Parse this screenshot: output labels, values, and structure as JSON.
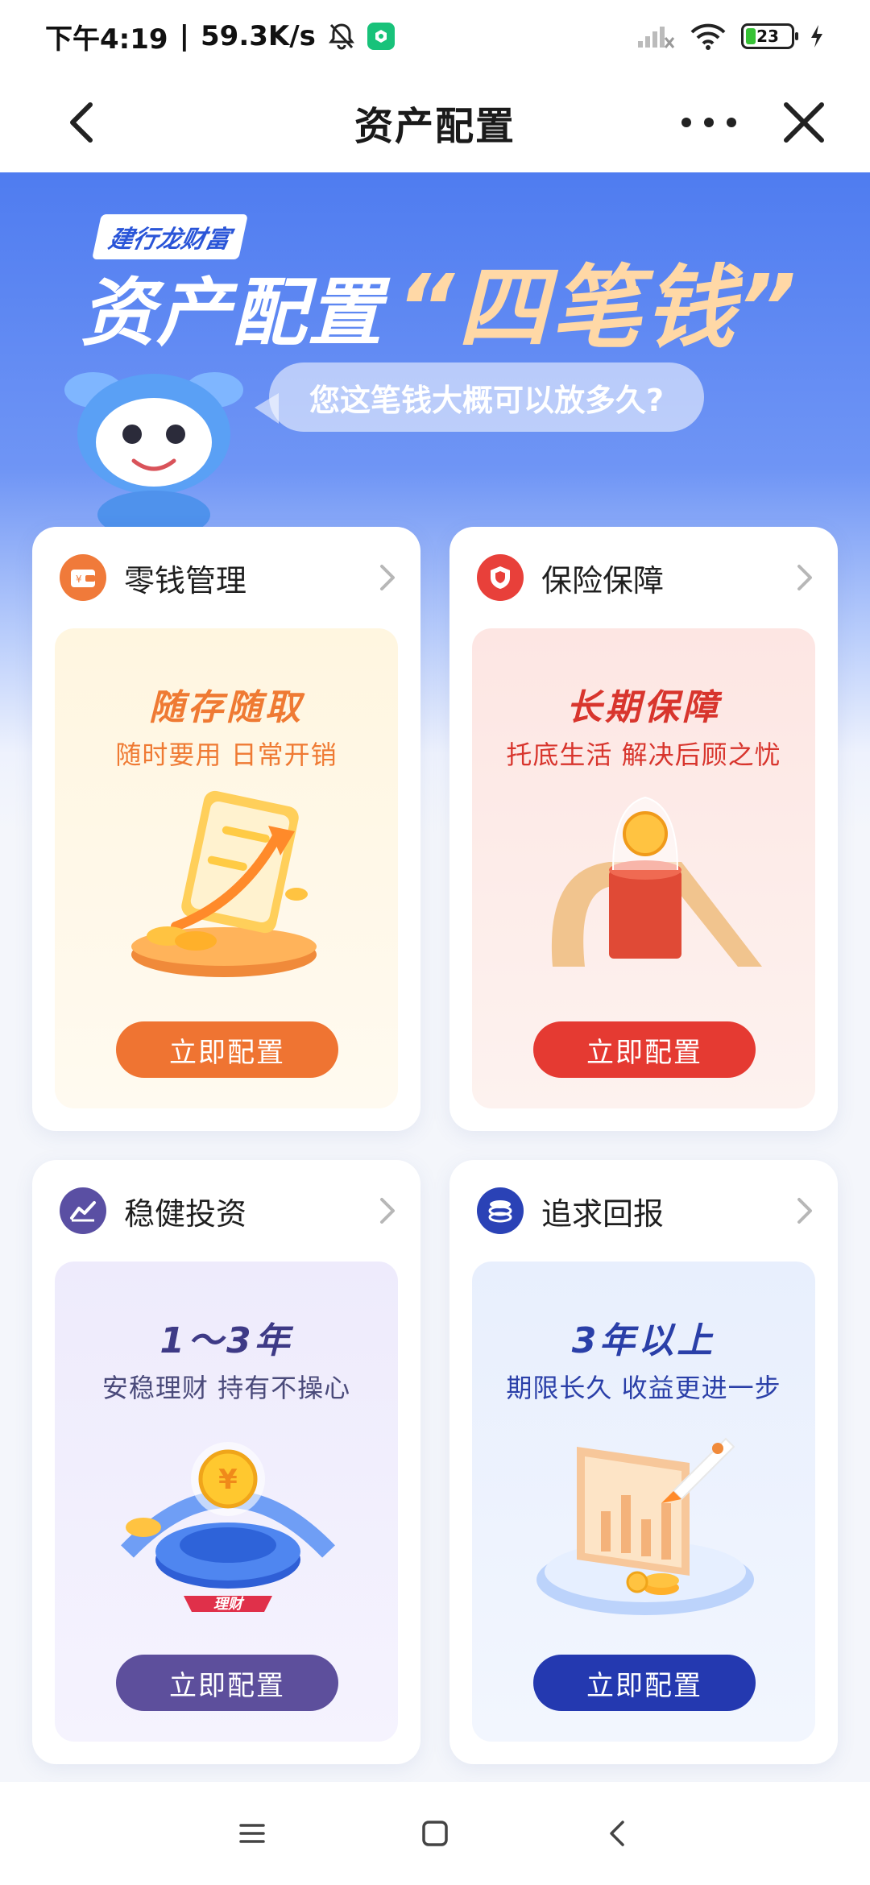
{
  "status_bar": {
    "time": "下午4:19",
    "net_speed": "59.3K/s",
    "separator": "|",
    "battery": "23"
  },
  "nav": {
    "title": "资产配置"
  },
  "hero": {
    "brand": "建行龙财富",
    "title": "资产配置",
    "title_highlight": "“四笔钱”",
    "bubble": "您这笔钱大概可以放多久?"
  },
  "cards": [
    {
      "title": "零钱管理",
      "headline": "随存随取",
      "sub": "随时要用 日常开销",
      "button": "立即配置",
      "icon": "wallet-icon",
      "accent": "#f07a3a",
      "headline_color": "#ef7a33",
      "panel_bg": "#fff5e1",
      "button_color": "#ef7432"
    },
    {
      "title": "保险保障",
      "headline": "长期保障",
      "sub": "托底生活 解决后顾之忧",
      "button": "立即配置",
      "icon": "shield-icon",
      "accent": "#e8403a",
      "headline_color": "#d8352d",
      "panel_bg": "#fde9e7",
      "button_color": "#e53a32"
    },
    {
      "title": "稳健投资",
      "headline": "1～3年",
      "sub": "安稳理财 持有不操心",
      "button": "立即配置",
      "icon": "chart-trend-icon",
      "accent": "#5a4fa3",
      "headline_color": "#3e3a86",
      "panel_bg": "#eeeafc",
      "button_color": "#5d4f9c"
    },
    {
      "title": "追求回报",
      "headline": "3年以上",
      "sub": "期限长久 收益更进一步",
      "button": "立即配置",
      "icon": "coins-stack-icon",
      "accent": "#2a42b6",
      "headline_color": "#2a3fa8",
      "panel_bg": "#e9f0fd",
      "button_color": "#2439b0"
    }
  ],
  "art_labels": {
    "coin": "¥",
    "licai": "理财"
  }
}
